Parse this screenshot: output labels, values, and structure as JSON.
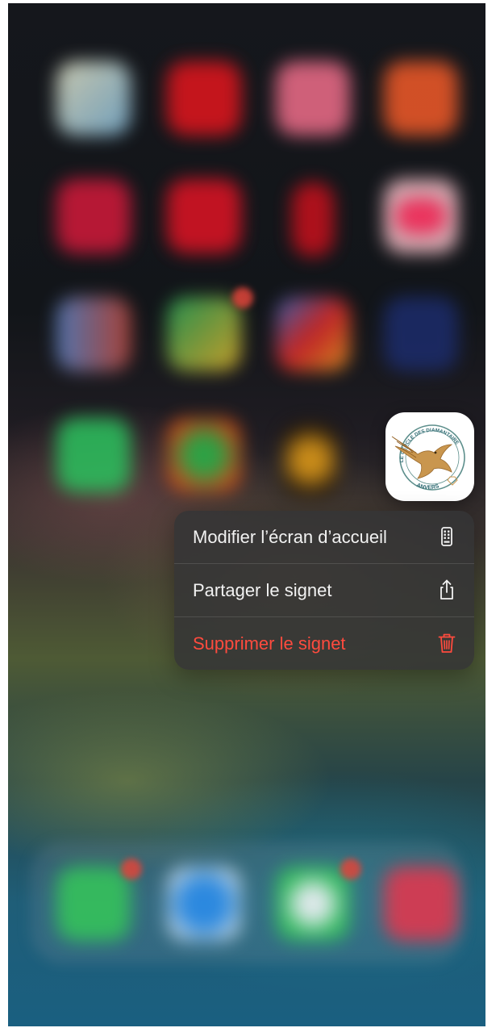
{
  "home_screen": {
    "state": "blurred background behind context menu"
  },
  "app_preview": {
    "name": "Le Cercle des Diamantaires Anvers bookmark",
    "logo_text_top": "LE CERCLE DES DIAMANTAIRES",
    "logo_text_bottom": "ANVERS"
  },
  "context_menu": {
    "items": [
      {
        "label": "Modifier l’écran d’accueil",
        "icon": "phone-screen-icon",
        "destructive": false
      },
      {
        "label": "Partager le signet",
        "icon": "share-icon",
        "destructive": false
      },
      {
        "label": "Supprimer le signet",
        "icon": "trash-icon",
        "destructive": true
      }
    ]
  },
  "colors": {
    "menu_background": "#343436",
    "menu_text": "#f2f2f2",
    "destructive_red": "#ff4b3e",
    "logo_gold": "#c9964e"
  }
}
